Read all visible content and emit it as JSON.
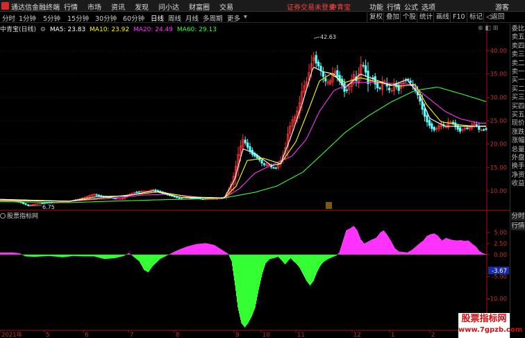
{
  "app": {
    "title": "通达信金融终端"
  },
  "menu": [
    {
      "label": "行情"
    },
    {
      "label": "市场"
    },
    {
      "label": "资讯"
    },
    {
      "label": "发现"
    },
    {
      "label": "问小达"
    },
    {
      "label": "财富圈"
    },
    {
      "label": "交易"
    }
  ],
  "top_notice": {
    "login": "证券交易未登录",
    "stock": "中青宝"
  },
  "top_tools": [
    {
      "label": "功能"
    },
    {
      "label": "行情"
    },
    {
      "label": "公式"
    },
    {
      "label": "选项"
    }
  ],
  "guest": "游客",
  "periods": [
    {
      "label": "分时"
    },
    {
      "label": "1分钟"
    },
    {
      "label": "5分钟"
    },
    {
      "label": "15分钟"
    },
    {
      "label": "30分钟"
    },
    {
      "label": "60分钟"
    },
    {
      "label": "日线"
    },
    {
      "label": "周线"
    },
    {
      "label": "月线"
    },
    {
      "label": "多周期"
    },
    {
      "label": "更多"
    }
  ],
  "right_tools": [
    {
      "label": "复权"
    },
    {
      "label": "叠加"
    },
    {
      "label": "个股"
    },
    {
      "label": "统计"
    },
    {
      "label": "画线"
    },
    {
      "label": "F10"
    },
    {
      "label": "标记"
    },
    {
      "label": "返回"
    }
  ],
  "chart_header": {
    "stock": "中青宝(日线)",
    "ma": [
      {
        "label": "MA5: 23.83",
        "color": "#ffffff"
      },
      {
        "label": "MA10: 23.92",
        "color": "#ffff00"
      },
      {
        "label": "MA20: 24.49",
        "color": "#ff33ff"
      },
      {
        "label": "MA60: 29.13",
        "color": "#33ff33"
      }
    ]
  },
  "sub_header": {
    "title": "股票指标网"
  },
  "side_panel": [
    "委比",
    "卖五",
    "卖四",
    "卖三",
    "卖二",
    "卖一",
    "买一",
    "买二",
    "买三",
    "买四",
    "买五",
    "现价",
    "涨跌",
    "涨幅",
    "总量",
    "外盘",
    "换手",
    "净资",
    "收益"
  ],
  "side_panel_lower": [
    "分时",
    "行情"
  ],
  "colors": {
    "up": "#ff3232",
    "down": "#54ffff",
    "ma5": "#ffffff",
    "ma10": "#ffff00",
    "ma20": "#ff33ff",
    "ma60": "#33ff33",
    "pos": "#ff33ff",
    "neg": "#33ff33"
  },
  "watermark": {
    "title": "股票指标网",
    "url": "www.7gpzb.com"
  },
  "chart_data": [
    {
      "type": "candlestick",
      "title": "中青宝(日线)",
      "y_ticks": [
        10.0,
        15.0,
        20.0,
        25.0,
        30.0,
        35.0,
        40.0
      ],
      "ylim": [
        6.0,
        44.0
      ],
      "annotations": [
        {
          "label": "42.63",
          "kind": "high"
        },
        {
          "label": "6.75",
          "kind": "low"
        }
      ],
      "x_labels": [
        "2021年",
        "5",
        "6",
        "7",
        "8",
        "9",
        "10",
        "11",
        "12",
        "1",
        "2"
      ],
      "series": [
        {
          "name": "MA5",
          "value": 23.83
        },
        {
          "name": "MA10",
          "value": 23.92
        },
        {
          "name": "MA20",
          "value": 24.49
        },
        {
          "name": "MA60",
          "value": 29.13
        }
      ],
      "price_path": [
        [
          0,
          8.2
        ],
        [
          10,
          8.0
        ],
        [
          20,
          7.9
        ],
        [
          30,
          7.5
        ],
        [
          40,
          6.9
        ],
        [
          55,
          7.3
        ],
        [
          70,
          7.5
        ],
        [
          85,
          7.6
        ],
        [
          100,
          7.8
        ],
        [
          110,
          8.1
        ],
        [
          125,
          8.8
        ],
        [
          135,
          9.3
        ],
        [
          145,
          8.8
        ],
        [
          155,
          8.6
        ],
        [
          165,
          8.4
        ],
        [
          175,
          8.3
        ],
        [
          181,
          8.9
        ],
        [
          192,
          9.6
        ],
        [
          205,
          10.0
        ],
        [
          213,
          9.9
        ],
        [
          220,
          10.3
        ],
        [
          232,
          9.6
        ],
        [
          245,
          9.0
        ],
        [
          255,
          8.6
        ],
        [
          262,
          8.3
        ],
        [
          272,
          8.4
        ],
        [
          282,
          8.5
        ],
        [
          292,
          8.2
        ],
        [
          302,
          8.3
        ],
        [
          312,
          8.3
        ],
        [
          323,
          8.6
        ],
        [
          327,
          9.5
        ],
        [
          332,
          11.0
        ],
        [
          338,
          14.0
        ],
        [
          344,
          18.5
        ],
        [
          350,
          21.0
        ],
        [
          356,
          19.5
        ],
        [
          362,
          18.0
        ],
        [
          367,
          17.5
        ],
        [
          373,
          16.8
        ],
        [
          379,
          15.5
        ],
        [
          385,
          15.8
        ],
        [
          391,
          15.0
        ],
        [
          398,
          14.8
        ],
        [
          404,
          16.5
        ],
        [
          410,
          18.5
        ],
        [
          414,
          22.0
        ],
        [
          420,
          25.0
        ],
        [
          426,
          26.0
        ],
        [
          431,
          28.5
        ],
        [
          436,
          32.0
        ],
        [
          441,
          33.0
        ],
        [
          446,
          36.0
        ],
        [
          451,
          39.0
        ],
        [
          455,
          37.5
        ],
        [
          460,
          36.5
        ],
        [
          465,
          34.5
        ],
        [
          470,
          33.0
        ],
        [
          476,
          33.5
        ],
        [
          481,
          36.0
        ],
        [
          487,
          34.0
        ],
        [
          492,
          33.0
        ],
        [
          497,
          31.0
        ],
        [
          503,
          32.5
        ],
        [
          509,
          35.0
        ],
        [
          514,
          33.0
        ],
        [
          519,
          37.0
        ],
        [
          525,
          36.5
        ],
        [
          530,
          33.0
        ],
        [
          536,
          34.5
        ],
        [
          540,
          33.0
        ],
        [
          546,
          31.5
        ],
        [
          552,
          34.0
        ],
        [
          558,
          32.0
        ],
        [
          563,
          31.0
        ],
        [
          568,
          33.0
        ],
        [
          574,
          31.5
        ],
        [
          580,
          33.5
        ],
        [
          586,
          34.0
        ],
        [
          592,
          33.0
        ],
        [
          598,
          31.5
        ],
        [
          604,
          29.5
        ],
        [
          609,
          27.0
        ],
        [
          614,
          25.0
        ],
        [
          619,
          24.0
        ],
        [
          624,
          23.0
        ],
        [
          630,
          23.5
        ],
        [
          635,
          24.5
        ],
        [
          641,
          23.5
        ],
        [
          646,
          24.8
        ],
        [
          652,
          24.5
        ],
        [
          657,
          23.5
        ],
        [
          663,
          22.8
        ],
        [
          668,
          23.5
        ],
        [
          674,
          23.3
        ],
        [
          679,
          24.0
        ],
        [
          684,
          24.5
        ],
        [
          690,
          23.0
        ],
        [
          695,
          23.0
        ],
        [
          700,
          23.3
        ]
      ],
      "ma5_path": [
        [
          0,
          8.2
        ],
        [
          100,
          7.8
        ],
        [
          140,
          8.8
        ],
        [
          181,
          8.9
        ],
        [
          220,
          10.0
        ],
        [
          262,
          8.6
        ],
        [
          323,
          8.5
        ],
        [
          338,
          12.5
        ],
        [
          350,
          19.0
        ],
        [
          367,
          18.0
        ],
        [
          391,
          15.4
        ],
        [
          404,
          15.8
        ],
        [
          420,
          22.0
        ],
        [
          436,
          29.0
        ],
        [
          451,
          36.5
        ],
        [
          465,
          35.5
        ],
        [
          481,
          35.0
        ],
        [
          497,
          32.0
        ],
        [
          519,
          35.0
        ],
        [
          540,
          33.8
        ],
        [
          563,
          32.5
        ],
        [
          586,
          33.8
        ],
        [
          604,
          30.5
        ],
        [
          619,
          25.5
        ],
        [
          641,
          23.8
        ],
        [
          663,
          23.8
        ],
        [
          684,
          23.8
        ],
        [
          700,
          23.8
        ]
      ],
      "ma10_path": [
        [
          0,
          8.0
        ],
        [
          100,
          7.8
        ],
        [
          145,
          8.5
        ],
        [
          192,
          9.2
        ],
        [
          230,
          9.8
        ],
        [
          272,
          8.7
        ],
        [
          323,
          8.5
        ],
        [
          340,
          11.0
        ],
        [
          356,
          16.5
        ],
        [
          379,
          17.0
        ],
        [
          404,
          15.8
        ],
        [
          426,
          20.5
        ],
        [
          446,
          28.0
        ],
        [
          460,
          33.5
        ],
        [
          476,
          35.0
        ],
        [
          497,
          33.2
        ],
        [
          519,
          34.2
        ],
        [
          546,
          33.2
        ],
        [
          574,
          32.4
        ],
        [
          598,
          32.7
        ],
        [
          614,
          28.5
        ],
        [
          635,
          24.8
        ],
        [
          657,
          24.2
        ],
        [
          684,
          23.8
        ],
        [
          700,
          23.9
        ]
      ],
      "ma20_path": [
        [
          0,
          7.9
        ],
        [
          100,
          7.8
        ],
        [
          150,
          8.3
        ],
        [
          205,
          9.1
        ],
        [
          245,
          9.3
        ],
        [
          290,
          8.6
        ],
        [
          323,
          8.5
        ],
        [
          345,
          10.5
        ],
        [
          367,
          13.8
        ],
        [
          398,
          16.0
        ],
        [
          420,
          17.4
        ],
        [
          441,
          21.0
        ],
        [
          460,
          27.0
        ],
        [
          481,
          31.5
        ],
        [
          509,
          33.2
        ],
        [
          536,
          33.2
        ],
        [
          563,
          33.0
        ],
        [
          592,
          32.8
        ],
        [
          614,
          30.2
        ],
        [
          641,
          27.0
        ],
        [
          663,
          25.4
        ],
        [
          690,
          24.5
        ],
        [
          700,
          24.5
        ]
      ],
      "ma60_path": [
        [
          0,
          7.7
        ],
        [
          100,
          7.5
        ],
        [
          160,
          7.8
        ],
        [
          230,
          8.1
        ],
        [
          290,
          8.3
        ],
        [
          323,
          8.5
        ],
        [
          367,
          9.7
        ],
        [
          398,
          11.0
        ],
        [
          436,
          14.0
        ],
        [
          465,
          18.0
        ],
        [
          497,
          22.5
        ],
        [
          530,
          26.0
        ],
        [
          563,
          29.0
        ],
        [
          598,
          31.5
        ],
        [
          630,
          32.2
        ],
        [
          663,
          30.8
        ],
        [
          700,
          29.1
        ]
      ]
    },
    {
      "type": "bar",
      "title": "股票指标网",
      "y_ticks": [
        5.0,
        2.5,
        0.0,
        -5.0,
        -10.0,
        -15.0
      ],
      "current_value": "-3.67",
      "ylim": [
        -17.0,
        8.0
      ],
      "envelope": [
        [
          0,
          0.5
        ],
        [
          18,
          0.5
        ],
        [
          28,
          0.3
        ],
        [
          36,
          -0.4
        ],
        [
          50,
          -0.5
        ],
        [
          70,
          -0.3
        ],
        [
          90,
          -0.6
        ],
        [
          105,
          -0.3
        ],
        [
          120,
          -0.4
        ],
        [
          135,
          -0.4
        ],
        [
          150,
          -1.0
        ],
        [
          165,
          -0.8
        ],
        [
          178,
          -0.3
        ],
        [
          185,
          0.4
        ],
        [
          192,
          -0.5
        ],
        [
          200,
          -1.5
        ],
        [
          207,
          -3.5
        ],
        [
          213,
          -4.0
        ],
        [
          220,
          -2.5
        ],
        [
          230,
          -1.0
        ],
        [
          240,
          -0.2
        ],
        [
          246,
          0.3
        ],
        [
          255,
          1.0
        ],
        [
          268,
          1.8
        ],
        [
          282,
          2.4
        ],
        [
          296,
          2.6
        ],
        [
          308,
          2.2
        ],
        [
          320,
          1.0
        ],
        [
          328,
          0.2
        ],
        [
          333,
          -1.5
        ],
        [
          338,
          -7.0
        ],
        [
          342,
          -12.0
        ],
        [
          347,
          -15.5
        ],
        [
          352,
          -16.5
        ],
        [
          357,
          -15.5
        ],
        [
          362,
          -14.0
        ],
        [
          367,
          -12.0
        ],
        [
          372,
          -8.0
        ],
        [
          377,
          -4.5
        ],
        [
          382,
          -2.0
        ],
        [
          388,
          -1.0
        ],
        [
          394,
          -0.8
        ],
        [
          400,
          -0.5
        ],
        [
          405,
          -1.3
        ],
        [
          410,
          -2.2
        ],
        [
          414,
          -1.5
        ],
        [
          418,
          -0.8
        ],
        [
          422,
          -1.5
        ],
        [
          426,
          -2.0
        ],
        [
          431,
          -3.0
        ],
        [
          436,
          -4.5
        ],
        [
          441,
          -6.0
        ],
        [
          446,
          -7.0
        ],
        [
          451,
          -6.0
        ],
        [
          456,
          -4.0
        ],
        [
          461,
          -2.5
        ],
        [
          466,
          -1.6
        ],
        [
          472,
          -1.0
        ],
        [
          478,
          -0.6
        ],
        [
          484,
          -0.2
        ],
        [
          488,
          0.5
        ],
        [
          493,
          3.0
        ],
        [
          498,
          5.5
        ],
        [
          504,
          6.0
        ],
        [
          509,
          6.5
        ],
        [
          514,
          5.5
        ],
        [
          519,
          3.5
        ],
        [
          524,
          2.5
        ],
        [
          530,
          3.0
        ],
        [
          536,
          3.5
        ],
        [
          541,
          3.8
        ],
        [
          547,
          5.0
        ],
        [
          552,
          5.5
        ],
        [
          557,
          4.5
        ],
        [
          563,
          3.0
        ],
        [
          568,
          1.5
        ],
        [
          574,
          0.7
        ],
        [
          580,
          0.6
        ],
        [
          586,
          0.5
        ],
        [
          592,
          1.0
        ],
        [
          598,
          1.8
        ],
        [
          604,
          2.6
        ],
        [
          609,
          3.2
        ],
        [
          614,
          4.2
        ],
        [
          619,
          4.6
        ],
        [
          625,
          4.8
        ],
        [
          630,
          4.3
        ],
        [
          636,
          3.2
        ],
        [
          642,
          3.8
        ],
        [
          647,
          3.5
        ],
        [
          652,
          3.3
        ],
        [
          658,
          3.2
        ],
        [
          663,
          3.3
        ],
        [
          668,
          3.1
        ],
        [
          674,
          3.2
        ],
        [
          680,
          2.4
        ],
        [
          685,
          1.8
        ],
        [
          690,
          0.8
        ],
        [
          695,
          0.3
        ],
        [
          700,
          0.1
        ]
      ]
    }
  ]
}
